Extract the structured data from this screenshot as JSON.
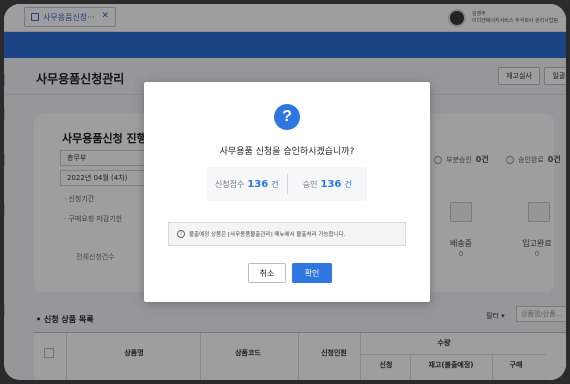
{
  "tabbar": {
    "tab_label": "사무용품신청···",
    "tab_close": "✕",
    "user_name": "김영주",
    "user_company": "이더앤에너지서비스 주식회사 관리사업팀"
  },
  "page": {
    "title": "사무용품신청관리",
    "btn_inventory": "재고실사",
    "btn_next": "일괄"
  },
  "card": {
    "title": "사무용품신청 진행",
    "select_dept": "총무부",
    "select_month": "2022년 04월 (4차)",
    "label_period": "· 신청기간",
    "label_deadline": "· 구매요청 마감기한",
    "label_total": "전체신청건수",
    "partial_label": "부분승인",
    "partial_count": "0건",
    "complete_label": "승인완료",
    "complete_count": "0건",
    "stage_delivery": "배송중",
    "stage_delivery_val": "0",
    "stage_stock": "입고완료",
    "stage_stock_val": "0"
  },
  "list": {
    "title": "• 신청 상품 목록",
    "filter": "필터 ▾",
    "search_placeholder": "상품명/상품...",
    "columns": {
      "product_name": "상품명",
      "product_code": "상품코드",
      "applicants": "신청인원",
      "quantity": "수량",
      "qty_apply": "신청",
      "qty_stock": "재고(불출예정)",
      "qty_purchase": "구매"
    }
  },
  "dialog": {
    "icon": "?",
    "message": "사무용품 신청을 승인하시겠습니까?",
    "received_label": "신청접수",
    "received_count": "136",
    "received_unit": "건",
    "approved_label": "승인",
    "approved_count": "136",
    "approved_unit": "건",
    "notice": "불출예정 상품은 [사무용품불출관리] 메뉴에서 불출처리 가능합니다.",
    "cancel": "취소",
    "confirm": "확인"
  },
  "colors": {
    "accent": "#2f76e0",
    "header": "#2f6fd6"
  }
}
